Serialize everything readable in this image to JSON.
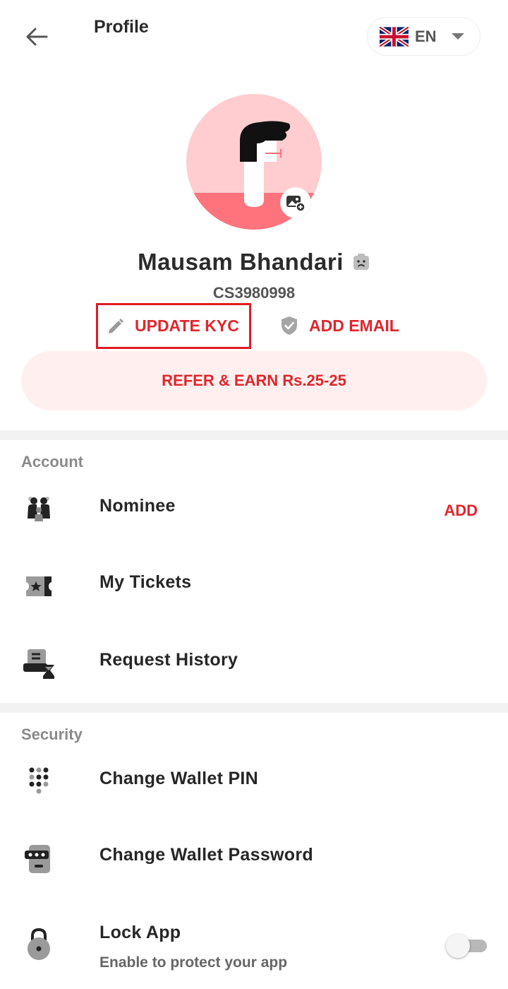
{
  "header": {
    "title": "Profile",
    "back_icon": "arrow-left-icon",
    "language": {
      "flag_icon": "uk-flag-icon",
      "code": "EN",
      "caret_icon": "caret-down-icon"
    }
  },
  "profile": {
    "avatar_icon": "avatar-f-illustration",
    "photo_edit_icon": "add-photo-icon",
    "name": "Mausam Bhandari",
    "status_icon": "sad-face-icon",
    "user_id": "CS3980998",
    "actions": {
      "update_kyc": {
        "label": "UPDATE KYC",
        "icon": "pencil-icon",
        "highlighted": true
      },
      "add_email": {
        "label": "ADD EMAIL",
        "icon": "shield-check-icon"
      }
    },
    "refer_label": "REFER & EARN Rs.25-25"
  },
  "sections": {
    "account": {
      "title": "Account",
      "items": [
        {
          "label": "Nominee",
          "icon": "family-icon",
          "action": "ADD"
        },
        {
          "label": "My Tickets",
          "icon": "ticket-icon"
        },
        {
          "label": "Request History",
          "icon": "history-icon"
        }
      ]
    },
    "security": {
      "title": "Security",
      "items": [
        {
          "label": "Change Wallet PIN",
          "icon": "keypad-icon"
        },
        {
          "label": "Change Wallet Password",
          "icon": "password-icon"
        },
        {
          "label": "Lock App",
          "subtitle": "Enable to protect your app",
          "icon": "lock-icon",
          "toggle_on": false
        }
      ]
    }
  },
  "colors": {
    "accent": "#e0262d",
    "refer_bg": "#fff0ef",
    "divider": "#f2f2f2",
    "avatar_bg": "#ffcdd0",
    "avatar_bottom": "#ff737d"
  }
}
